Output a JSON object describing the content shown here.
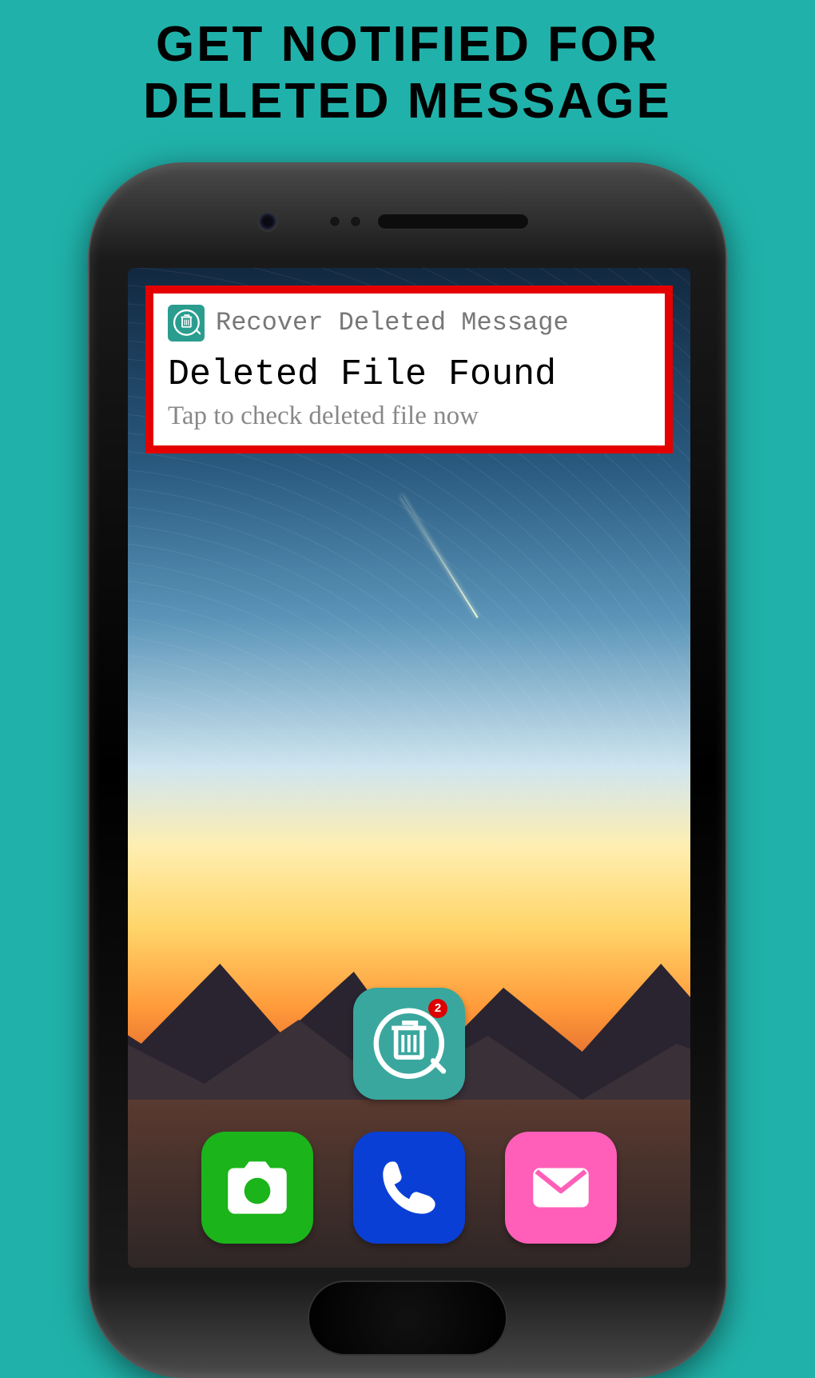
{
  "headline_line1": "GET NOTIFIED FOR",
  "headline_line2": "DELETED MESSAGE",
  "notification": {
    "app_name": "Recover Deleted Message",
    "title": "Deleted File Found",
    "subtitle": "Tap to check deleted file now"
  },
  "apps": {
    "recover_badge": "2"
  },
  "colors": {
    "background": "#20b2aa",
    "notif_border": "#e40000",
    "camera": "#1bb41b",
    "phone": "#0a3fd6",
    "mail": "#ff5fb8",
    "recover": "#3aa79e"
  }
}
